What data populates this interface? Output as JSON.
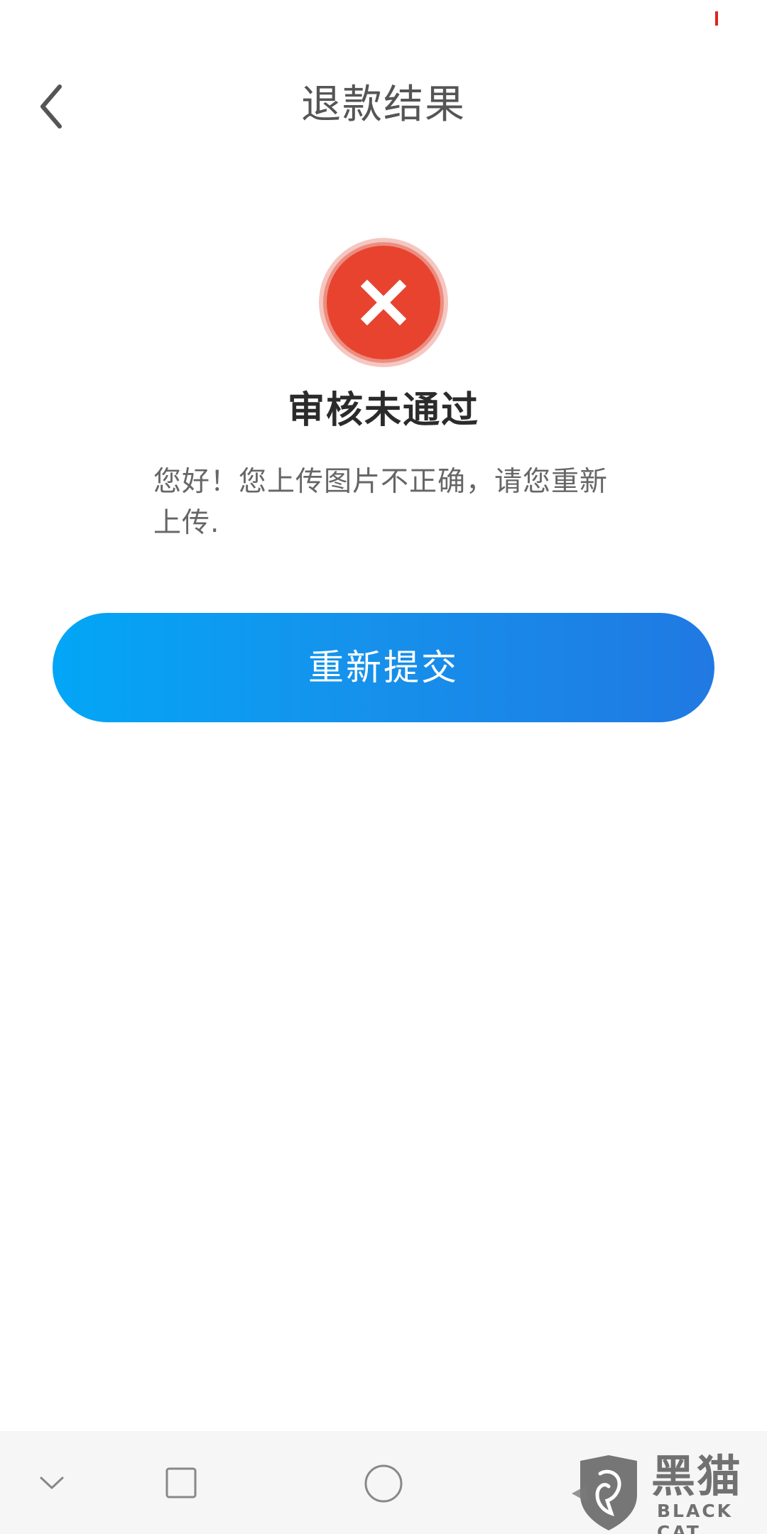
{
  "header": {
    "title": "退款结果",
    "back_icon": "chevron-left-icon"
  },
  "result": {
    "status_icon": "error-x-icon",
    "status_color": "#e8432f",
    "title": "审核未通过",
    "message": "您好！您上传图片不正确，请您重新上传."
  },
  "actions": {
    "resubmit_label": "重新提交",
    "gradient_start": "#03a6f6",
    "gradient_end": "#2079e2"
  },
  "nav_bar": {
    "back_icon": "chevron-down-icon",
    "recent_icon": "square-icon",
    "home_icon": "circle-icon"
  },
  "watermark": {
    "logo_icon": "black-cat-shield-icon",
    "cn": "黑猫",
    "en": "BLACK CAT"
  }
}
